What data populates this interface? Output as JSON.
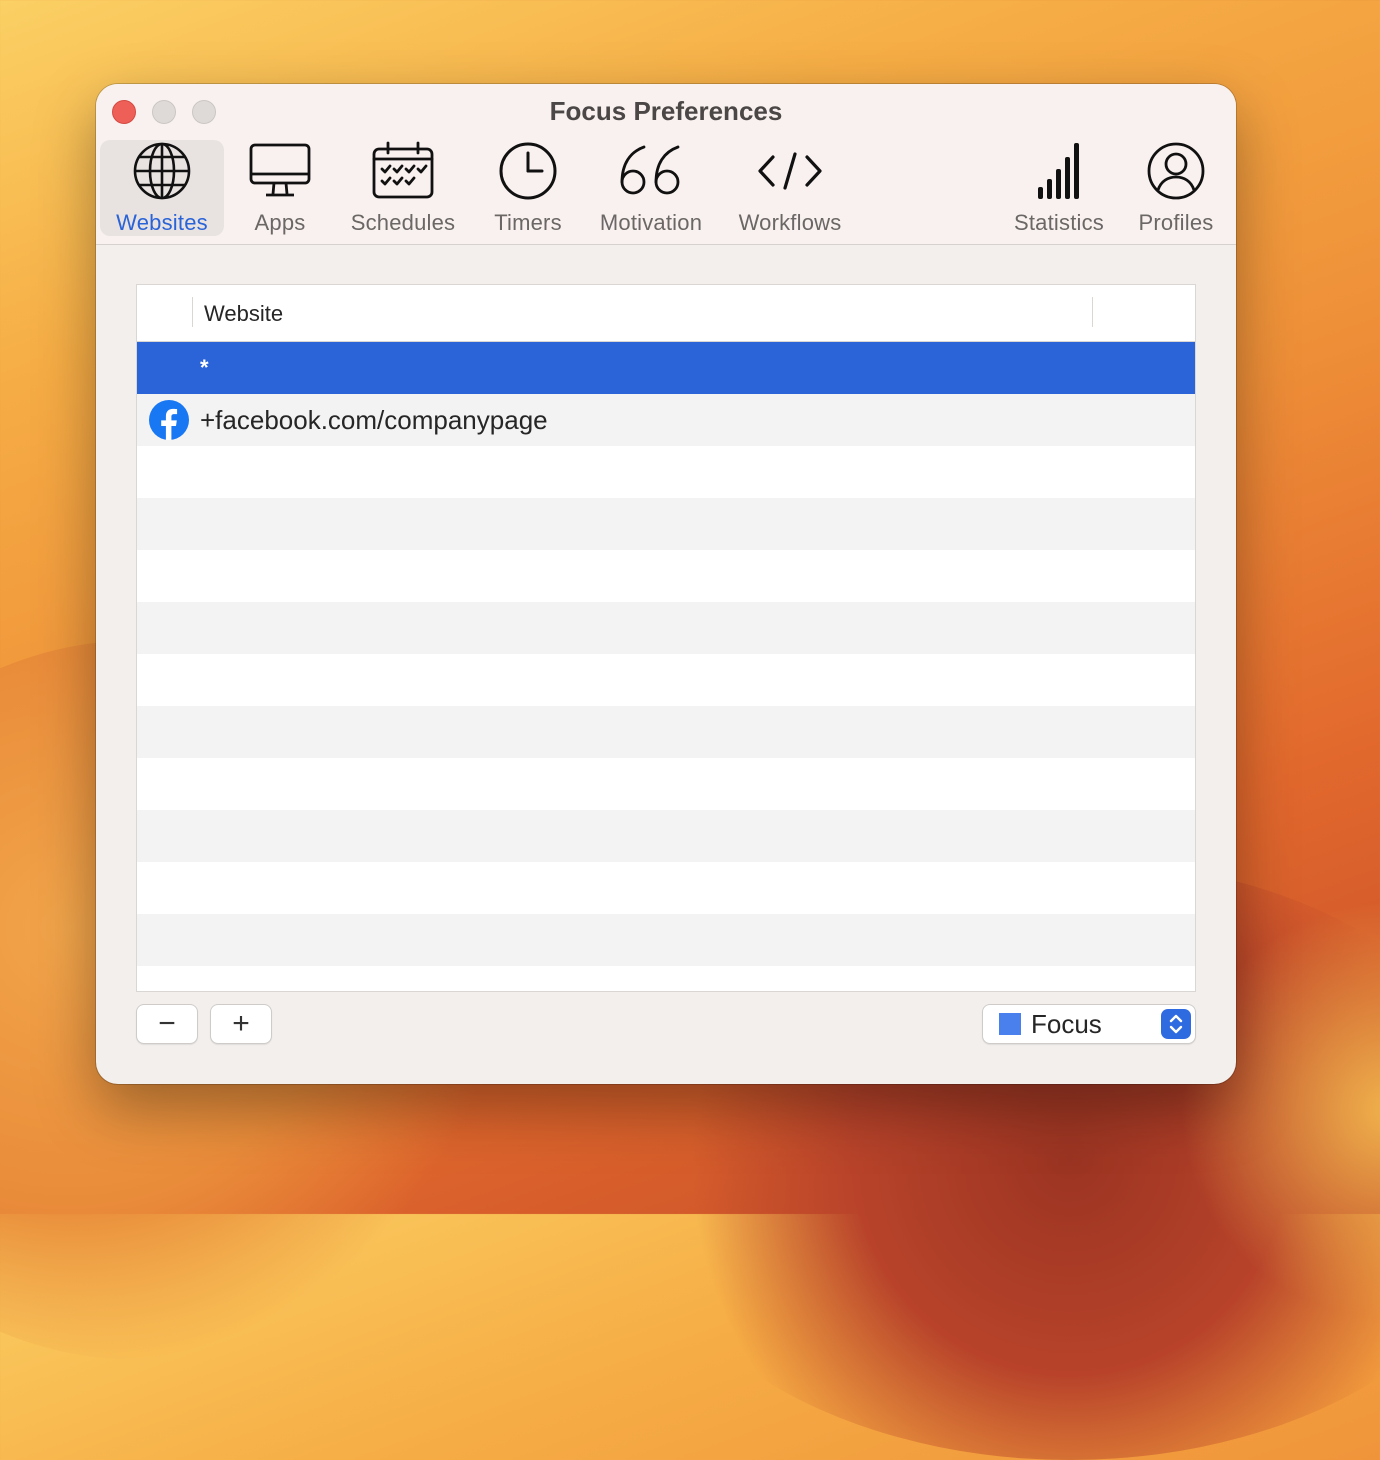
{
  "window": {
    "title": "Focus Preferences"
  },
  "toolbar": {
    "items": [
      {
        "label": "Websites",
        "icon": "globe-icon",
        "active": true
      },
      {
        "label": "Apps",
        "icon": "desktop-icon",
        "active": false
      },
      {
        "label": "Schedules",
        "icon": "calendar-icon",
        "active": false
      },
      {
        "label": "Timers",
        "icon": "clock-icon",
        "active": false
      },
      {
        "label": "Motivation",
        "icon": "quote-icon",
        "active": false
      },
      {
        "label": "Workflows",
        "icon": "code-icon",
        "active": false
      },
      {
        "label": "Statistics",
        "icon": "bar-chart-icon",
        "active": false
      },
      {
        "label": "Profiles",
        "icon": "person-circle-icon",
        "active": false
      }
    ]
  },
  "table": {
    "header": {
      "website": "Website"
    },
    "rows": [
      {
        "text": "*",
        "selected": true,
        "icon": null
      },
      {
        "text": "+facebook.com/companypage",
        "selected": false,
        "icon": "facebook-icon"
      }
    ]
  },
  "bottom": {
    "remove_label": "−",
    "add_label": "+",
    "profile_select": {
      "value": "Focus",
      "swatch_color": "#4a80ee"
    }
  },
  "colors": {
    "accent": "#2a63d8",
    "selection": "#2b64d9",
    "close_light": "#ee5f57",
    "facebook": "#1877f2"
  }
}
